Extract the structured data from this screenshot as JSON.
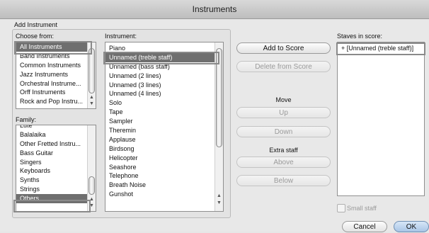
{
  "window": {
    "title": "Instruments"
  },
  "add_instrument": {
    "group_label": "Add Instrument",
    "choose_from": {
      "label": "Choose from:",
      "items": [
        "All Instruments",
        "Band Instruments",
        "Common Instruments",
        "Jazz Instruments",
        "Orchestral Instrume...",
        "Orff Instruments",
        "Rock and Pop Instru..."
      ],
      "selected": 0
    },
    "family": {
      "label": "Family:",
      "items": [
        "Lute",
        "Balalaika",
        "Other Fretted Instru...",
        "Bass Guitar",
        "Singers",
        "Keyboards",
        "Synths",
        "Strings",
        "Others"
      ],
      "selected": 8
    },
    "instrument": {
      "label": "Instrument:",
      "items": [
        "Piano",
        "Unnamed (treble staff)",
        "Unnamed (bass staff)",
        "Unnamed (2 lines)",
        "Unnamed (3 lines)",
        "Unnamed (4 lines)",
        "Solo",
        "Tape",
        "Sampler",
        "Theremin",
        "Applause",
        "Birdsong",
        "Helicopter",
        "Seashore",
        "Telephone",
        "Breath Noise",
        "Gunshot"
      ],
      "selected": 1
    }
  },
  "buttons": {
    "add_to_score": "Add to Score",
    "delete_from_score": "Delete from Score",
    "move_label": "Move",
    "up": "Up",
    "down": "Down",
    "extra_staff_label": "Extra staff",
    "above": "Above",
    "below": "Below",
    "cancel": "Cancel",
    "ok": "OK"
  },
  "staves": {
    "label": "Staves in score:",
    "items": [
      "+ [Unnamed (treble staff)]"
    ]
  },
  "small_staff": {
    "label": "Small staff",
    "checked": false
  }
}
